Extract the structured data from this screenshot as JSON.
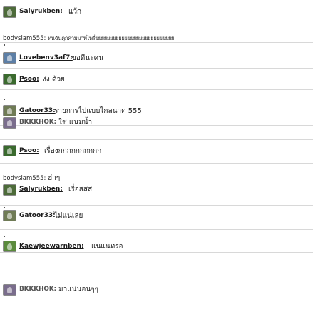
{
  "messages": [
    {
      "user": "Salyrukben:",
      "text": "แว้ก",
      "avatar_color": "#4d6b3a"
    },
    {
      "user": "bodyslam555:",
      "text": "ทนฉันคุกคามมาพี่ไพรี่ยยยยยยยยยยยยยยยยยยยยยยยยยยย",
      "avatar_color": ""
    },
    {
      "user": "Lovebenv3af7:",
      "text": "ขอดีนะคน",
      "avatar_color": "#5d7fa6"
    },
    {
      "user": "Psoo:",
      "text": "ง่ง ด้วย",
      "avatar_color": "#3a6a2e"
    },
    {
      "user": "Gatoor33:",
      "text": "รายการไปแบบไกลนาด 555",
      "avatar_color": "#6f7b55"
    },
    {
      "user": "BKKKHOK:",
      "text": "ใช่ แนมน้ำ",
      "avatar_color": "#7a6d8c"
    },
    {
      "user": "Psoo:",
      "text": "เรื่องกกกกกกกกกก",
      "avatar_color": "#3a6a2e"
    },
    {
      "user": "bodyslam555:",
      "text": "ฮ่าๆ",
      "avatar_color": ""
    },
    {
      "user": "Salyrukben:",
      "text": "เรื่อสสส",
      "avatar_color": "#4d6b3a"
    },
    {
      "user": "Gatoor33:",
      "text": "ไม่แน่เลย",
      "avatar_color": "#6f7b55"
    },
    {
      "user": "Kaewjeewarnben:",
      "text": "แนแนทรอ",
      "avatar_color": "#5a8a3c"
    },
    {
      "user": "BKKKHOK:",
      "text": "มาแน่นอนๆๆ",
      "avatar_color": "#7a6d8c"
    }
  ]
}
